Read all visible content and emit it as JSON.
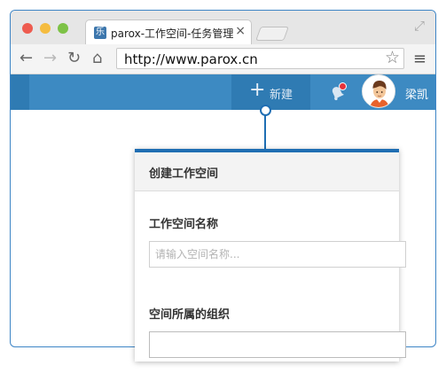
{
  "browser": {
    "tab": {
      "favicon_glyph": "乐",
      "title": "parox-工作空间-任务管理",
      "close_glyph": "×"
    },
    "nav": {
      "back_glyph": "←",
      "forward_glyph": "→",
      "reload_glyph": "↻",
      "home_glyph": "⌂"
    },
    "url": "http://www.parox.cn",
    "star_glyph": "☆",
    "menu_glyph": "≡",
    "fullscreen_glyph": "⤢"
  },
  "appbar": {
    "new_plus": "+",
    "new_label": "新建",
    "username": "梁凯",
    "accent_color": "#3d8ac2"
  },
  "dialog": {
    "title": "创建工作空间",
    "name_label": "工作空间名称",
    "name_placeholder": "请输入空间名称...",
    "org_label": "空间所属的组织",
    "org_value": ""
  },
  "icons": {
    "notification": "bell-icon",
    "avatar": "user-avatar"
  }
}
